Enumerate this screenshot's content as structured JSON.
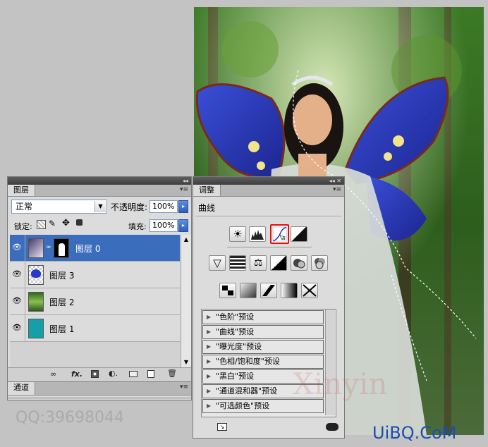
{
  "layers_panel": {
    "tab": "图层",
    "blend_mode": "正常",
    "opacity_label": "不透明度:",
    "opacity_value": "100%",
    "lock_label": "锁定:",
    "fill_label": "填充:",
    "fill_value": "100%",
    "layers": [
      {
        "name": "图层 0",
        "selected": true
      },
      {
        "name": "图层 3",
        "selected": false
      },
      {
        "name": "图层 2",
        "selected": false
      },
      {
        "name": "图层 1",
        "selected": false
      }
    ],
    "footer_icons": [
      "link-icon",
      "fx-icon",
      "mask-icon",
      "adjustment-layer-icon",
      "group-icon",
      "new-layer-icon",
      "trash-icon"
    ],
    "fx_label": "fx."
  },
  "channels_panel": {
    "tab": "通道"
  },
  "adjustments_panel": {
    "tab": "调整",
    "title": "曲线",
    "presets": [
      "\"色阶\"预设",
      "\"曲线\"预设",
      "\"曝光度\"预设",
      "\"色相/饱和度\"预设",
      "\"黑白\"预设",
      "\"通道混和器\"预设",
      "\"可选颜色\"预设"
    ]
  },
  "watermarks": {
    "qq": "QQ:39698044",
    "site": "UiBQ.CoM",
    "faint_brand": "Xinyin"
  },
  "colors": {
    "selection": "#3b6dbd",
    "highlight_box": "#e01010",
    "site_mark": "#1a4fb0"
  }
}
